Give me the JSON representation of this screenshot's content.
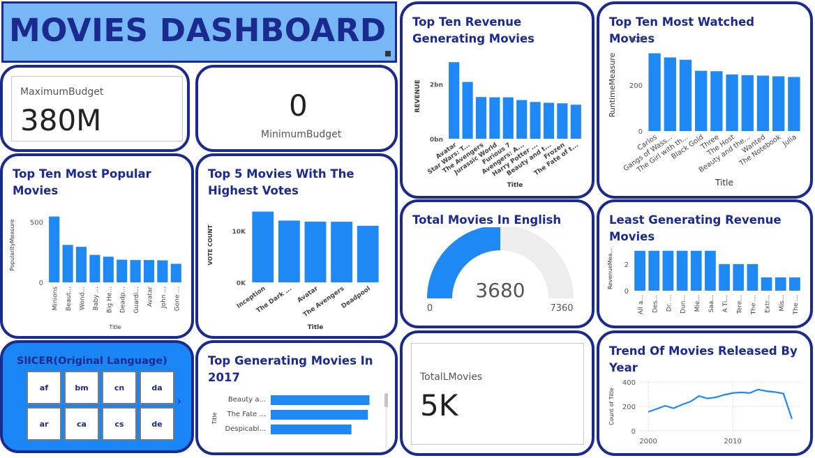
{
  "header": {
    "title": "MOVIES DASHBOARD"
  },
  "colors": {
    "accent": "#1a2a8f",
    "bar": "#1e88f5",
    "header_bg": "#77b7f5",
    "slicer_bg": "#1a86f5",
    "gauge_track": "#ededed"
  },
  "kpi_max_budget": {
    "label": "MaximumBudget",
    "value": "380M"
  },
  "kpi_min_budget": {
    "label": "MinimumBudget",
    "value": "0"
  },
  "kpi_total_movies": {
    "label": "TotalLMovies",
    "value": "5K"
  },
  "slicer": {
    "title": "SlICER(Original Language)",
    "options": [
      "af",
      "bm",
      "cn",
      "da",
      "ar",
      "ca",
      "cs",
      "de"
    ],
    "more_icon": "chevron-right-icon"
  },
  "gauge": {
    "title": "Total Movies In English",
    "value_label": "3680",
    "min_label": "0",
    "max_label": "7360",
    "value": 3680,
    "max": 7360
  },
  "chart_data": [
    {
      "id": "revenue",
      "type": "bar",
      "title": "Top Ten Revenue Generating Movies",
      "xlabel": "Title",
      "ylabel": "REVENUE",
      "yticks": [
        "0bn",
        "2bn"
      ],
      "ylim": [
        0,
        3.1
      ],
      "categories": [
        "Avatar",
        "Star Wars: T...",
        "The Avengers",
        "Jurassic World",
        "Furious 7",
        "Avengers: A...",
        "Harry Potter ...",
        "Beauty and t...",
        "Frozen",
        "The Fate of t..."
      ],
      "values": [
        2.79,
        2.07,
        1.52,
        1.51,
        1.51,
        1.41,
        1.34,
        1.31,
        1.29,
        1.24
      ]
    },
    {
      "id": "watched",
      "type": "bar",
      "title": "Top Ten Most Watched Movies",
      "xlabel": "Title",
      "ylabel": "RuntimeMeasure",
      "yticks": [
        "0",
        "200",
        "400"
      ],
      "ylim": [
        0,
        400
      ],
      "categories": [
        "Carlos",
        "Gangs of Wass...",
        "The Girl with th...",
        "Black Gold",
        "Three",
        "The Host",
        "Beauty and the...",
        "Wanted",
        "The Notebook",
        "Julia"
      ],
      "values": [
        338,
        320,
        310,
        262,
        260,
        246,
        243,
        241,
        238,
        235
      ]
    },
    {
      "id": "popular",
      "type": "bar",
      "title": "Top Ten Most Popular Movies",
      "xlabel": "Title",
      "ylabel": "PopularityMeasure",
      "yticks": [
        "0",
        "500"
      ],
      "ylim": [
        0,
        620
      ],
      "categories": [
        "Minions",
        "Beaut...",
        "Wond...",
        "Baby ...",
        "Big He...",
        "Deadp...",
        "Guardi...",
        "Avatar",
        "John ...",
        "Gone ..."
      ],
      "values": [
        547,
        311,
        295,
        228,
        213,
        188,
        185,
        185,
        183,
        154
      ]
    },
    {
      "id": "votes",
      "type": "bar",
      "title": "Top 5 Movies With The Highest Votes",
      "xlabel": "Title",
      "ylabel": "VOTE COUNT",
      "yticks": [
        "0K",
        "10K"
      ],
      "ylim": [
        0,
        14500
      ],
      "categories": [
        "Inception",
        "The Dark ...",
        "Avatar",
        "The Avengers",
        "Deadpool"
      ],
      "values": [
        13752,
        12002,
        11800,
        11776,
        10995
      ]
    },
    {
      "id": "least",
      "type": "bar",
      "title": "Least Generating Revenue Movies",
      "xlabel": "",
      "ylabel": "RevenueMea...",
      "yticks": [
        "0",
        "2"
      ],
      "ylim": [
        0,
        3.3
      ],
      "categories": [
        "All a...",
        "Des...",
        "Dr. ...",
        "Dun...",
        "Mie...",
        "Saa...",
        "A Ti...",
        "Tere...",
        "The ...",
        "Extr...",
        "Mis...",
        "The ..."
      ],
      "values": [
        3,
        3,
        3,
        3,
        3,
        3,
        2,
        2,
        2,
        1,
        1,
        1
      ]
    },
    {
      "id": "y2017",
      "type": "bar",
      "orientation": "horizontal",
      "title": "Top Generating Movies In 2017",
      "xlabel": "",
      "ylabel": "Title",
      "categories": [
        "Beauty a...",
        "The Fate ...",
        "Despicabl..."
      ],
      "values": [
        1.26,
        1.24,
        1.03
      ],
      "xlim": [
        0,
        1.3
      ]
    },
    {
      "id": "trend",
      "type": "line",
      "title": "Trend Of Movies Released By Year",
      "xlabel": "",
      "ylabel": "Count of Title",
      "yticks": [
        "0",
        "200",
        "400"
      ],
      "xticks": [
        "2000",
        "2010"
      ],
      "ylim": [
        0,
        400
      ],
      "xlim": [
        1999,
        2018
      ],
      "x": [
        2000,
        2001,
        2002,
        2003,
        2004,
        2005,
        2006,
        2007,
        2008,
        2009,
        2010,
        2011,
        2012,
        2013,
        2014,
        2015,
        2016,
        2017
      ],
      "values": [
        155,
        180,
        205,
        185,
        215,
        240,
        285,
        265,
        275,
        295,
        310,
        315,
        310,
        338,
        325,
        318,
        305,
        98
      ]
    }
  ]
}
